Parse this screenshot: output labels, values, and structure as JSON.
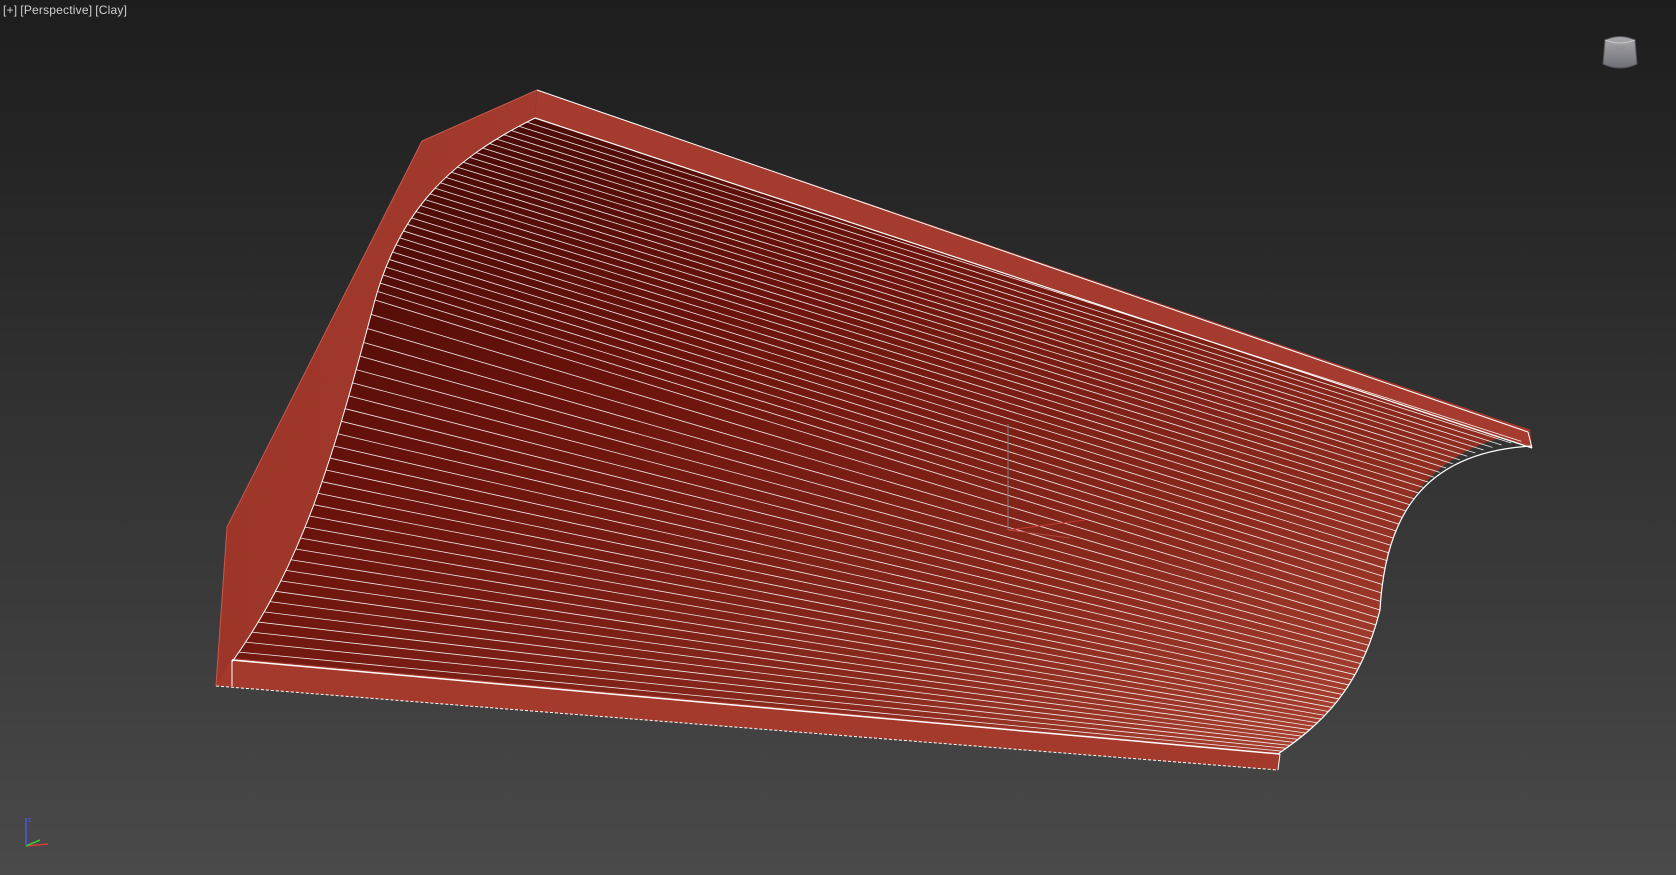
{
  "viewport": {
    "labels": {
      "plus": "[+]",
      "view": "[Perspective]",
      "shading": "[Clay]"
    },
    "viewcube_icon": "viewcube-icon",
    "axis_icon": "axis-tripod-icon",
    "colors": {
      "background_top": "#1d1d1d",
      "background_bottom": "#4a4a4a",
      "model_face": "#9b3328",
      "model_surface_dark": "#5a0d08",
      "wireframe": "#ffffff",
      "label_text": "#d0d0d0"
    },
    "model": {
      "type": "crown-molding",
      "wire_segments": 62
    }
  }
}
